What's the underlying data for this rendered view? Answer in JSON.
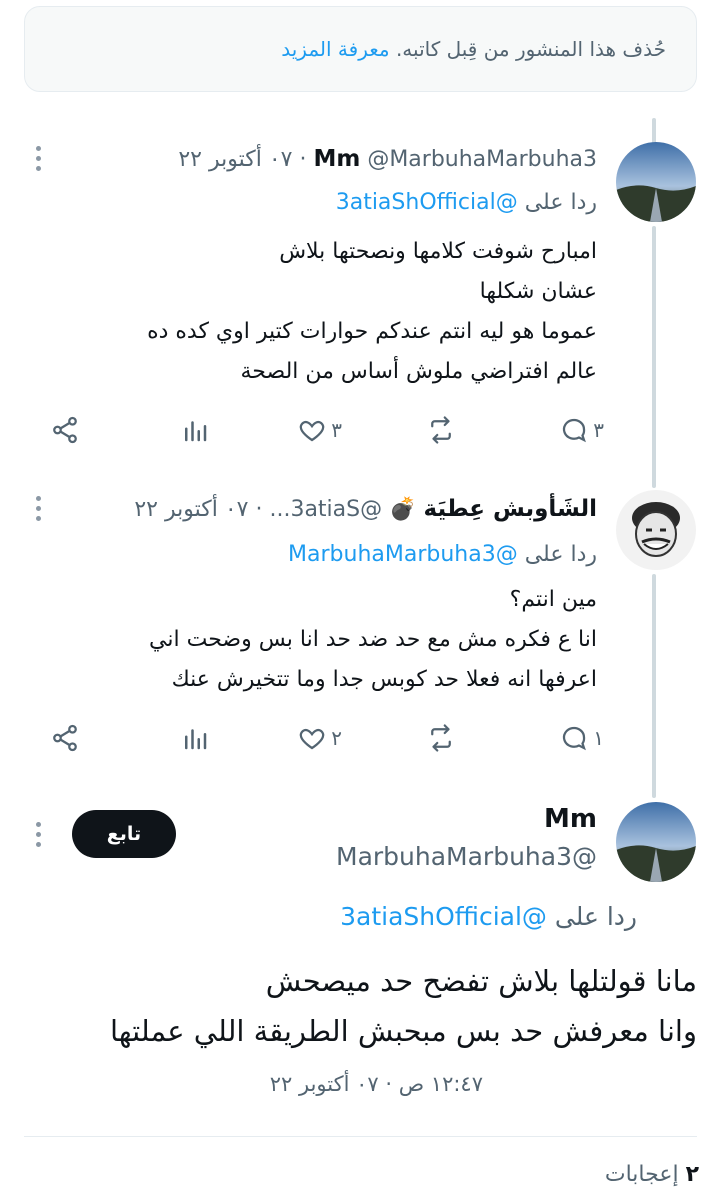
{
  "notice": {
    "text": "حُذف هذا المنشور من قِبل كاتبه. ",
    "link": "معرفة المزيد"
  },
  "replies": [
    {
      "name": "Mm",
      "handle": "@MarbuhaMarbuha3",
      "date": "· ٠٧ أكتوبر ٢٢",
      "reply_prefix": "ردا على ",
      "reply_handle": "@3atiaShOfficial",
      "lines": [
        "امبارح شوفت كلامها ونصحتها بلاش",
        "عشان شكلها",
        "عموما هو ليه انتم عندكم حوارات كتير اوي كده ده",
        "عالم افتراضي ملوش أساس من الصحة"
      ],
      "counts": {
        "replies": "٣",
        "retweets": "",
        "likes": "٣",
        "views": ""
      }
    },
    {
      "name": "الشَأوبش عِطيَة",
      "emoji": "💣",
      "handle": "@3atiaS...",
      "date": "· ٠٧ أكتوبر ٢٢",
      "reply_prefix": "ردا على ",
      "reply_handle": "@MarbuhaMarbuha3",
      "lines": [
        "مين انتم؟",
        "انا ع فكره مش مع حد ضد حد انا بس وضحت اني",
        "اعرفها انه فعلا حد كوبس جدا وما تتخيرش عنك"
      ],
      "counts": {
        "replies": "١",
        "retweets": "",
        "likes": "٢",
        "views": ""
      }
    }
  ],
  "main_tweet": {
    "name": "Mm",
    "handle": "@MarbuhaMarbuha3",
    "follow_label": "تابع",
    "reply_prefix": "ردا على ",
    "reply_handle": "@3atiaShOfficial",
    "lines": [
      "مانا قولتلها بلاش تفضح حد ميصحش",
      "وانا معرفش حد بس مبحبش الطريقة اللي عملتها"
    ],
    "timestamp": "١٢:٤٧ ص · ٠٧ أكتوبر ٢٢",
    "likes_count": "٢",
    "likes_label": " إعجابات"
  },
  "icons": {
    "reply": "speech-bubble-icon",
    "retweet": "retweet-icon",
    "like": "heart-icon",
    "views": "bar-chart-icon",
    "share": "share-icon",
    "more": "vertical-dots-icon"
  },
  "colors": {
    "link": "#1d9bf0",
    "secondary": "#536471",
    "text": "#0f1419",
    "thread_line": "#cfd9de"
  }
}
